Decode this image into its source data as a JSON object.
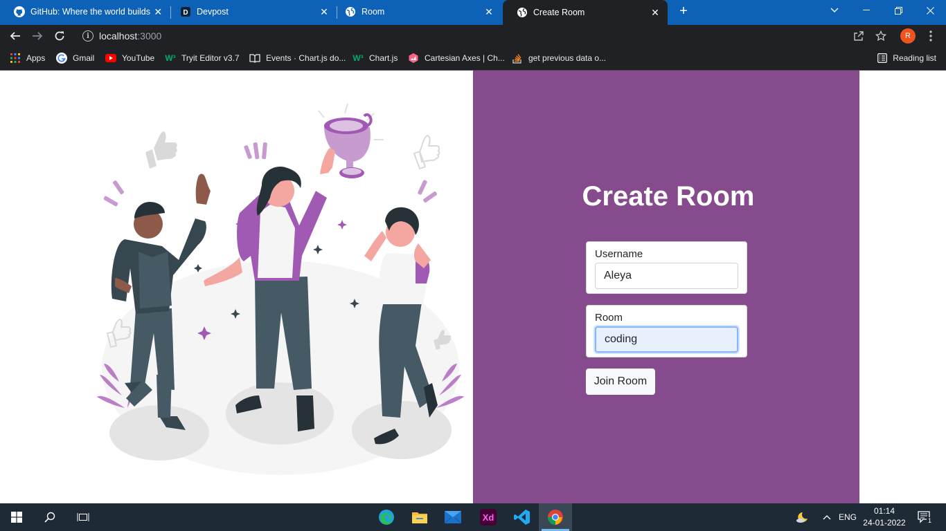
{
  "browser": {
    "tabs": [
      {
        "title": "GitHub: Where the world builds s",
        "icon": "github-icon",
        "active": false
      },
      {
        "title": "Devpost",
        "icon": "devpost-icon",
        "active": false
      },
      {
        "title": "Room",
        "icon": "globe-icon",
        "active": false
      },
      {
        "title": "Create Room",
        "icon": "globe-icon",
        "active": true
      }
    ],
    "new_tab": "+",
    "url_host": "localhost",
    "url_port": ":3000",
    "profile_initial": "R",
    "bookmarks": [
      {
        "label": "Apps",
        "icon": "apps-grid-icon"
      },
      {
        "label": "Gmail",
        "icon": "google-icon"
      },
      {
        "label": "YouTube",
        "icon": "youtube-icon"
      },
      {
        "label": "Tryit Editor v3.7",
        "icon": "w3schools-icon"
      },
      {
        "label": "Events · Chart.js do...",
        "icon": "book-icon"
      },
      {
        "label": "Chart.js",
        "icon": "w3schools-icon"
      },
      {
        "label": "Cartesian Axes | Ch...",
        "icon": "chartjs-icon"
      },
      {
        "label": "get previous data o...",
        "icon": "stackoverflow-icon"
      }
    ],
    "reading_list": "Reading list"
  },
  "form": {
    "title": "Create Room",
    "username_label": "Username",
    "username_value": "Aleya",
    "room_label": "Room",
    "room_value": "coding",
    "submit_label": "Join Room"
  },
  "colors": {
    "panel": "#864b8c",
    "tabstrip": "#0d62b8",
    "toolbar": "#202124",
    "taskbar": "#1e2a36"
  },
  "taskbar": {
    "language": "ENG",
    "time": "01:14",
    "date": "24-01-2022",
    "notification_count": "1",
    "apps": [
      "edge-icon",
      "file-explorer-icon",
      "mail-icon",
      "adobe-xd-icon",
      "vscode-icon",
      "chrome-icon"
    ]
  }
}
